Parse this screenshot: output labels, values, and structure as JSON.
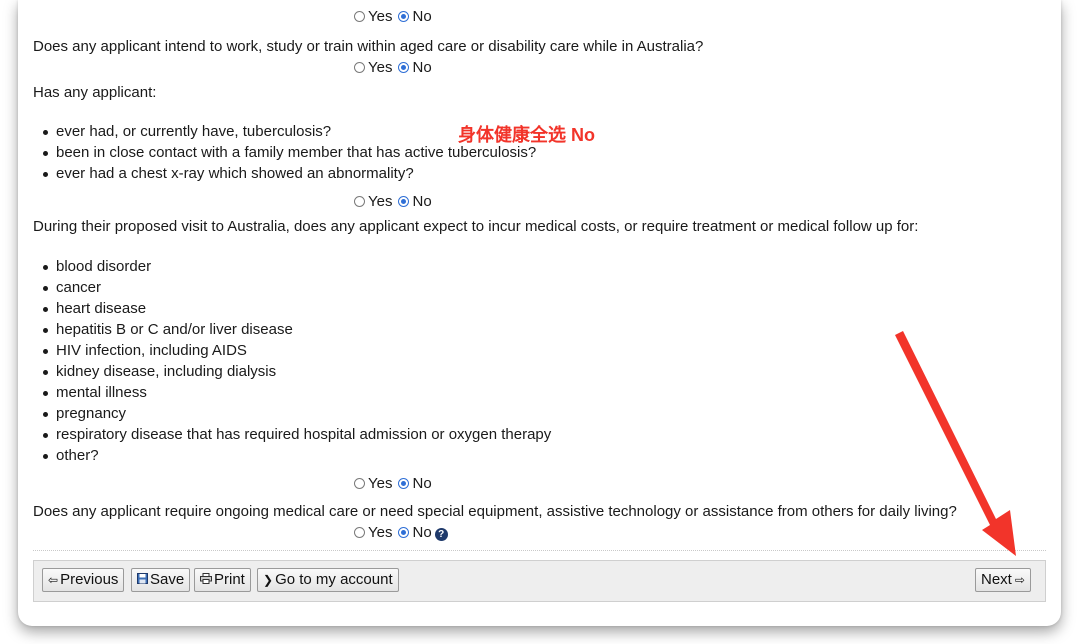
{
  "q_top": {
    "yes_label": "Yes",
    "no_label": "No"
  },
  "q_aged_care": {
    "text": "Does any applicant intend to work, study or train within aged care or disability care while in Australia?",
    "yes_label": "Yes",
    "no_label": "No"
  },
  "q_tb": {
    "intro": "Has any applicant:",
    "items": [
      "ever had, or currently have, tuberculosis?",
      "been in close contact with a family member that has active tuberculosis?",
      "ever had a chest x-ray which showed an abnormality?"
    ],
    "yes_label": "Yes",
    "no_label": "No"
  },
  "annotation": "身体健康全选 No",
  "q_medical": {
    "text": "During their proposed visit to Australia, does any applicant expect to incur medical costs, or require treatment or medical follow up for:",
    "items": [
      "blood disorder",
      "cancer",
      "heart disease",
      "hepatitis B or C and/or liver disease",
      "HIV infection, including AIDS",
      "kidney disease, including dialysis",
      "mental illness",
      "pregnancy",
      "respiratory disease that has required hospital admission or oxygen therapy",
      "other?"
    ],
    "yes_label": "Yes",
    "no_label": "No"
  },
  "q_ongoing": {
    "text": "Does any applicant require ongoing medical care or need special equipment, assistive technology or assistance from others for daily living?",
    "yes_label": "Yes",
    "no_label": "No",
    "help_icon": "question-circle-icon"
  },
  "footer": {
    "previous": "Previous",
    "save": "Save",
    "print": "Print",
    "account": "Go to my account",
    "next": "Next"
  },
  "colors": {
    "annotation": "#f2342a",
    "radio_checked": "#2f6fd6"
  }
}
